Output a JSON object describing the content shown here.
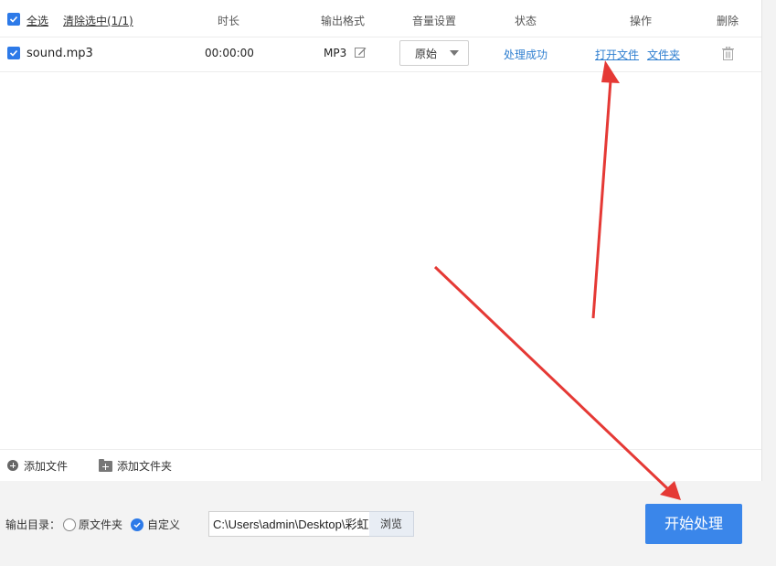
{
  "header": {
    "select_all": "全选",
    "clear_selection": "清除选中(1/1)",
    "col_duration": "时长",
    "col_output_format": "输出格式",
    "col_volume": "音量设置",
    "col_status": "状态",
    "col_actions": "操作",
    "col_delete": "删除"
  },
  "rows": [
    {
      "filename": "sound.mp3",
      "duration": "00:00:00",
      "format": "MP3",
      "volume": "原始",
      "status": "处理成功",
      "open_file": "打开文件",
      "open_folder": "文件夹"
    }
  ],
  "bottom": {
    "add_file": "添加文件",
    "add_folder": "添加文件夹"
  },
  "output": {
    "label": "输出目录：",
    "option_original": "原文件夹",
    "option_custom": "自定义",
    "selected": "自定义",
    "path": "C:\\Users\\admin\\Desktop\\彩虹",
    "browse": "浏览"
  },
  "start_button": "开始处理",
  "icons": {
    "checkbox": "checkmark-icon",
    "edit": "edit-icon",
    "dropdown": "chevron-down-icon",
    "delete": "trash-icon",
    "add_file": "plus-circle-icon",
    "add_folder": "folder-plus-icon"
  },
  "colors": {
    "accent": "#2d7ae8",
    "link": "#2f7fd0",
    "start_button": "#3a86ea",
    "annotation_arrow": "#e53935"
  }
}
